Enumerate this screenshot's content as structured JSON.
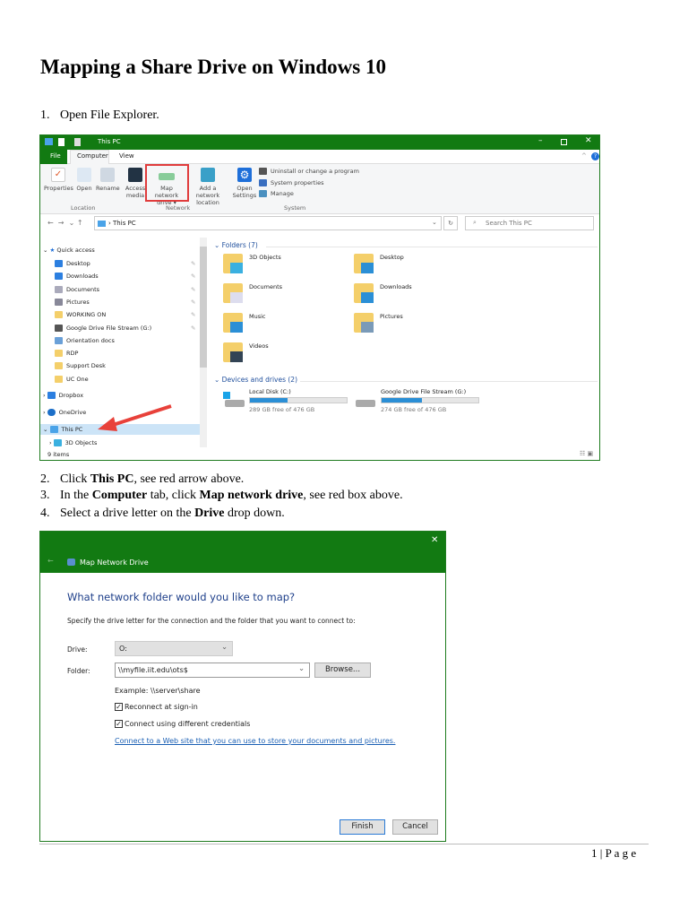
{
  "title": "Mapping a Share Drive on Windows 10",
  "steps": [
    {
      "num": "1.",
      "text": "Open File Explorer."
    },
    {
      "num": "2.",
      "pre": "Click ",
      "bold": "This PC",
      "post": ", see red arrow above."
    },
    {
      "num": "3.",
      "pre": "In the ",
      "bold": "Computer",
      "mid": " tab, click ",
      "bold2": "Map network drive",
      "post": ", see red box above."
    },
    {
      "num": "4.",
      "pre": "Select a drive letter on the ",
      "bold": "Drive",
      "post": " drop down."
    }
  ],
  "explorer": {
    "window_title": "This PC",
    "tabs": [
      "File",
      "Computer",
      "View"
    ],
    "ribbon": {
      "properties": "Properties",
      "open": "Open",
      "rename": "Rename",
      "access_media": "Access media",
      "map_network_drive": "Map network drive",
      "add_network_location": "Add a network location",
      "open_settings": "Open Settings",
      "uninstall": "Uninstall or change a program",
      "system_properties": "System properties",
      "manage": "Manage",
      "groups": [
        "Location",
        "Network",
        "System"
      ]
    },
    "address": "This PC",
    "search_placeholder": "Search This PC",
    "sidebar": {
      "quick_access": "Quick access",
      "items": [
        "Desktop",
        "Downloads",
        "Documents",
        "Pictures",
        "WORKING ON",
        "Google Drive File Stream (G:)",
        "Orientation docs",
        "RDP",
        "Support Desk",
        "UC One"
      ],
      "dropbox": "Dropbox",
      "onedrive": "OneDrive",
      "this_pc": "This PC",
      "objects3d": "3D Objects"
    },
    "status": "9 items",
    "folders_header": "Folders (7)",
    "folders": [
      "3D Objects",
      "Desktop",
      "Documents",
      "Downloads",
      "Music",
      "Pictures",
      "Videos"
    ],
    "drives_header": "Devices and drives (2)",
    "drives": [
      {
        "name": "Local Disk (C:)",
        "free": "289 GB free of 476 GB",
        "used_fraction": 0.39
      },
      {
        "name": "Google Drive File Stream (G:)",
        "free": "274 GB free of 476 GB",
        "used_fraction": 0.42
      }
    ],
    "colors": {
      "titlebar": "#127a12",
      "highlight_box": "#e03c3c",
      "arrow": "#e8413a"
    }
  },
  "dialog": {
    "title": "Map Network Drive",
    "heading": "What network folder would you like to map?",
    "instructions": "Specify the drive letter for the connection and the folder that you want to connect to:",
    "drive_label": "Drive:",
    "drive_value": "O:",
    "folder_label": "Folder:",
    "folder_value": "\\\\myfile.iit.edu\\ots$",
    "browse": "Browse...",
    "example": "Example: \\\\server\\share",
    "reconnect": "Reconnect at sign-in",
    "credentials": "Connect using different credentials",
    "link": "Connect to a Web site that you can use to store your documents and pictures.",
    "finish": "Finish",
    "cancel": "Cancel"
  },
  "footer": {
    "page": "1 | P a g e"
  }
}
